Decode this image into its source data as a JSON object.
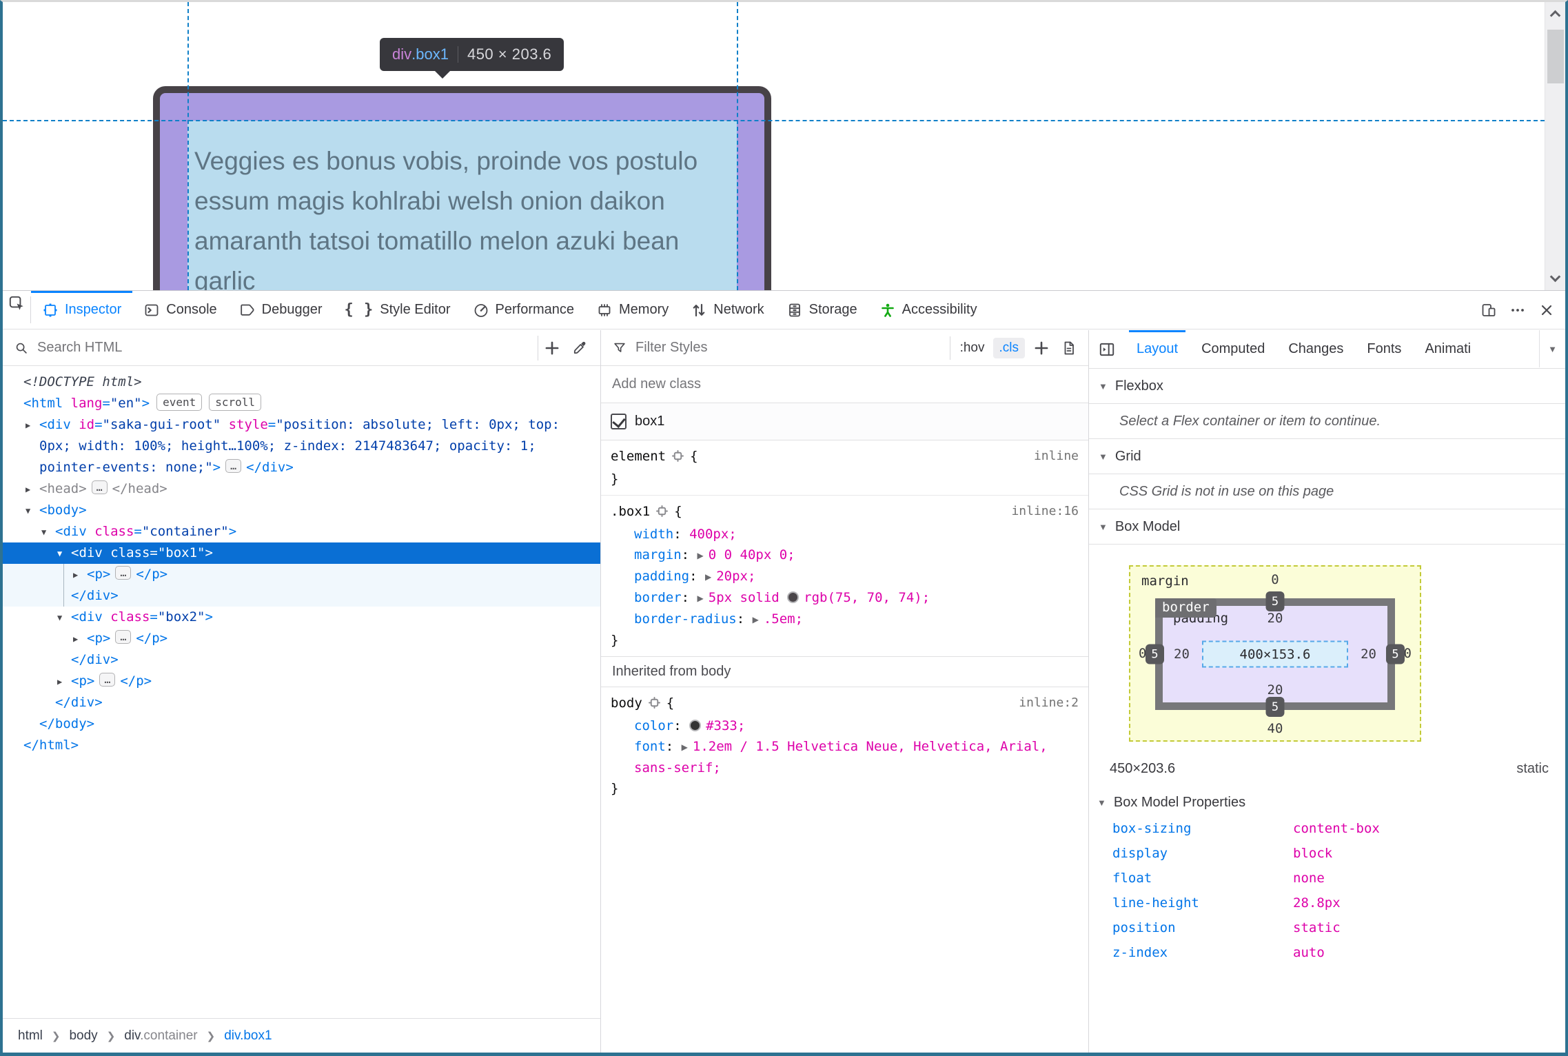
{
  "page": {
    "tooltip": {
      "tag": "div",
      "cls": ".box1",
      "sep": "|",
      "dims": "450 × 203.6"
    },
    "box_text_lines": [
      "Veggies es bonus vobis, proinde vos postulo",
      "essum magis kohlrabi welsh onion daikon",
      "amaranth tatsoi tomatillo melon azuki bean",
      "garlic"
    ],
    "colors": {
      "box_border": "#474247",
      "padding_overlay": "#a99ae1",
      "content_overlay": "#b9dcee",
      "guide": "#1080c8"
    }
  },
  "toolbar": {
    "tabs": [
      {
        "label": "Inspector",
        "icon": "inspector-icon",
        "active": true
      },
      {
        "label": "Console",
        "icon": "console-icon"
      },
      {
        "label": "Debugger",
        "icon": "debugger-icon"
      },
      {
        "label": "Style Editor",
        "icon": "style-editor-icon"
      },
      {
        "label": "Performance",
        "icon": "performance-icon"
      },
      {
        "label": "Memory",
        "icon": "memory-icon"
      },
      {
        "label": "Network",
        "icon": "network-icon"
      },
      {
        "label": "Storage",
        "icon": "storage-icon"
      },
      {
        "label": "Accessibility",
        "icon": "accessibility-icon",
        "icon_color": "#12a912"
      }
    ],
    "right_icons": [
      {
        "name": "responsive-design-mode-icon",
        "icon": "responsive-icon"
      },
      {
        "name": "more-tools-icon",
        "icon": "more-icon"
      },
      {
        "name": "close-devtools-icon",
        "icon": "close-icon"
      }
    ]
  },
  "markup": {
    "search_placeholder": "Search HTML",
    "rows": [
      {
        "lvl": 0,
        "segs": [
          [
            "doc",
            "<!DOCTYPE html>"
          ]
        ]
      },
      {
        "lvl": 0,
        "segs": [
          [
            "tag",
            "<html"
          ],
          [
            "attr",
            " lang"
          ],
          [
            "tag",
            "="
          ],
          [
            "val",
            "\"en\""
          ],
          [
            "tag",
            ">"
          ],
          [
            "badge",
            "event"
          ],
          [
            "badge",
            "scroll"
          ]
        ]
      },
      {
        "lvl": 1,
        "exp": "r",
        "segs": [
          [
            "tag",
            "<div"
          ],
          [
            "attr",
            " id"
          ],
          [
            "tag",
            "="
          ],
          [
            "val",
            "\"saka-gui-root\""
          ],
          [
            "attr",
            " style"
          ],
          [
            "tag",
            "="
          ],
          [
            "val",
            "\"position: absolute; left: 0px; top: 0px; width: 100%; height…100%; z-index: 2147483647; opacity: 1; pointer-events: none;\""
          ],
          [
            "tag",
            ">"
          ],
          [
            "dots",
            "…"
          ],
          [
            "tag",
            "</div>"
          ]
        ]
      },
      {
        "lvl": 1,
        "exp": "r",
        "segs": [
          [
            "gray",
            "<head>"
          ],
          [
            "dots",
            "…"
          ],
          [
            "gray",
            "</head>"
          ]
        ]
      },
      {
        "lvl": 1,
        "exp": "d",
        "segs": [
          [
            "tag",
            "<body>"
          ]
        ]
      },
      {
        "lvl": 2,
        "exp": "d",
        "segs": [
          [
            "tag",
            "<div"
          ],
          [
            "attr",
            " class"
          ],
          [
            "tag",
            "="
          ],
          [
            "val",
            "\"container\""
          ],
          [
            "tag",
            ">"
          ]
        ]
      },
      {
        "lvl": 3,
        "exp": "d",
        "sel": true,
        "segs": [
          [
            "tag",
            "<div"
          ],
          [
            "attr",
            " class"
          ],
          [
            "tag",
            "="
          ],
          [
            "val",
            "\"box1\""
          ],
          [
            "tag",
            ">"
          ]
        ]
      },
      {
        "lvl": 4,
        "exp": "r",
        "child": true,
        "line": true,
        "segs": [
          [
            "tag",
            "<p>"
          ],
          [
            "dots",
            "…"
          ],
          [
            "tag",
            "</p>"
          ]
        ]
      },
      {
        "lvl": 3,
        "child": true,
        "line": true,
        "segs": [
          [
            "tag",
            "</div>"
          ]
        ]
      },
      {
        "lvl": 3,
        "exp": "d",
        "segs": [
          [
            "tag",
            "<div"
          ],
          [
            "attr",
            " class"
          ],
          [
            "tag",
            "="
          ],
          [
            "val",
            "\"box2\""
          ],
          [
            "tag",
            ">"
          ]
        ]
      },
      {
        "lvl": 4,
        "exp": "r",
        "segs": [
          [
            "tag",
            "<p>"
          ],
          [
            "dots",
            "…"
          ],
          [
            "tag",
            "</p>"
          ]
        ]
      },
      {
        "lvl": 3,
        "segs": [
          [
            "tag",
            "</div>"
          ]
        ]
      },
      {
        "lvl": 3,
        "exp": "r",
        "segs": [
          [
            "tag",
            "<p>"
          ],
          [
            "dots",
            "…"
          ],
          [
            "tag",
            "</p>"
          ]
        ]
      },
      {
        "lvl": 2,
        "segs": [
          [
            "tag",
            "</div>"
          ]
        ]
      },
      {
        "lvl": 1,
        "segs": [
          [
            "tag",
            "</body>"
          ]
        ]
      },
      {
        "lvl": 0,
        "segs": [
          [
            "tag",
            "</html>"
          ]
        ]
      }
    ],
    "breadcrumbs": [
      {
        "tag": "html"
      },
      {
        "tag": "body"
      },
      {
        "tag": "div",
        "cls": ".container"
      },
      {
        "tag": "div.box1",
        "active": true
      }
    ]
  },
  "styles": {
    "filter_placeholder": "Filter Styles",
    "toolbar": {
      "hov": ":hov",
      "cls": ".cls"
    },
    "add_class_placeholder": "Add new class",
    "class_toggle": {
      "label": "box1",
      "checked": true
    },
    "rules": [
      {
        "selector": "element",
        "location": "inline",
        "props": []
      },
      {
        "selector": ".box1",
        "location": "inline:16",
        "props": [
          {
            "name": "width",
            "segs": [
              [
                "v",
                "400px;"
              ]
            ]
          },
          {
            "name": "margin",
            "arrow": true,
            "segs": [
              [
                "v",
                "0 0 40px 0;"
              ]
            ]
          },
          {
            "name": "padding",
            "arrow": true,
            "segs": [
              [
                "v",
                "20px;"
              ]
            ]
          },
          {
            "name": "border",
            "arrow": true,
            "segs": [
              [
                "v",
                "5px solid "
              ],
              [
                "swatch",
                "#4b464a"
              ],
              [
                "v",
                "rgb(75, 70, 74);"
              ]
            ]
          },
          {
            "name": "border-radius",
            "arrow": true,
            "segs": [
              [
                "v",
                ".5em;"
              ]
            ]
          }
        ]
      }
    ],
    "inherited_header": "Inherited from body",
    "body_rules": [
      {
        "selector": "body",
        "location": "inline:2",
        "props": [
          {
            "name": "color",
            "segs": [
              [
                "swatch",
                "#333333"
              ],
              [
                "v",
                "#333;"
              ]
            ]
          },
          {
            "name": "font",
            "arrow": true,
            "segs": [
              [
                "v",
                "1.2em / 1.5 Helvetica Neue, Helvetica, Arial, sans-serif;"
              ]
            ]
          }
        ]
      }
    ]
  },
  "layout_panel": {
    "tabs": [
      {
        "label": "Layout",
        "active": true
      },
      {
        "label": "Computed"
      },
      {
        "label": "Changes"
      },
      {
        "label": "Fonts"
      },
      {
        "label": "Animati"
      }
    ],
    "sections": {
      "flexbox": {
        "title": "Flexbox",
        "message": "Select a Flex container or item to continue."
      },
      "grid": {
        "title": "Grid",
        "message": "CSS Grid is not in use on this page"
      },
      "boxmodel": {
        "title": "Box Model"
      }
    },
    "box_model": {
      "margin_label": "margin",
      "border_label": "border",
      "padding_label": "padding",
      "content": "400×153.6",
      "margin": {
        "top": "0",
        "right": "0",
        "bottom": "40",
        "left": "0"
      },
      "border": {
        "top": "5",
        "right": "5",
        "bottom": "5",
        "left": "5"
      },
      "padding": {
        "top": "20",
        "right": "20",
        "bottom": "20",
        "left": "20"
      }
    },
    "dims": "450×203.6",
    "position": "static",
    "properties_title": "Box Model Properties",
    "properties": [
      [
        "box-sizing",
        "content-box"
      ],
      [
        "display",
        "block"
      ],
      [
        "float",
        "none"
      ],
      [
        "line-height",
        "28.8px"
      ],
      [
        "position",
        "static"
      ],
      [
        "z-index",
        "auto"
      ]
    ]
  }
}
